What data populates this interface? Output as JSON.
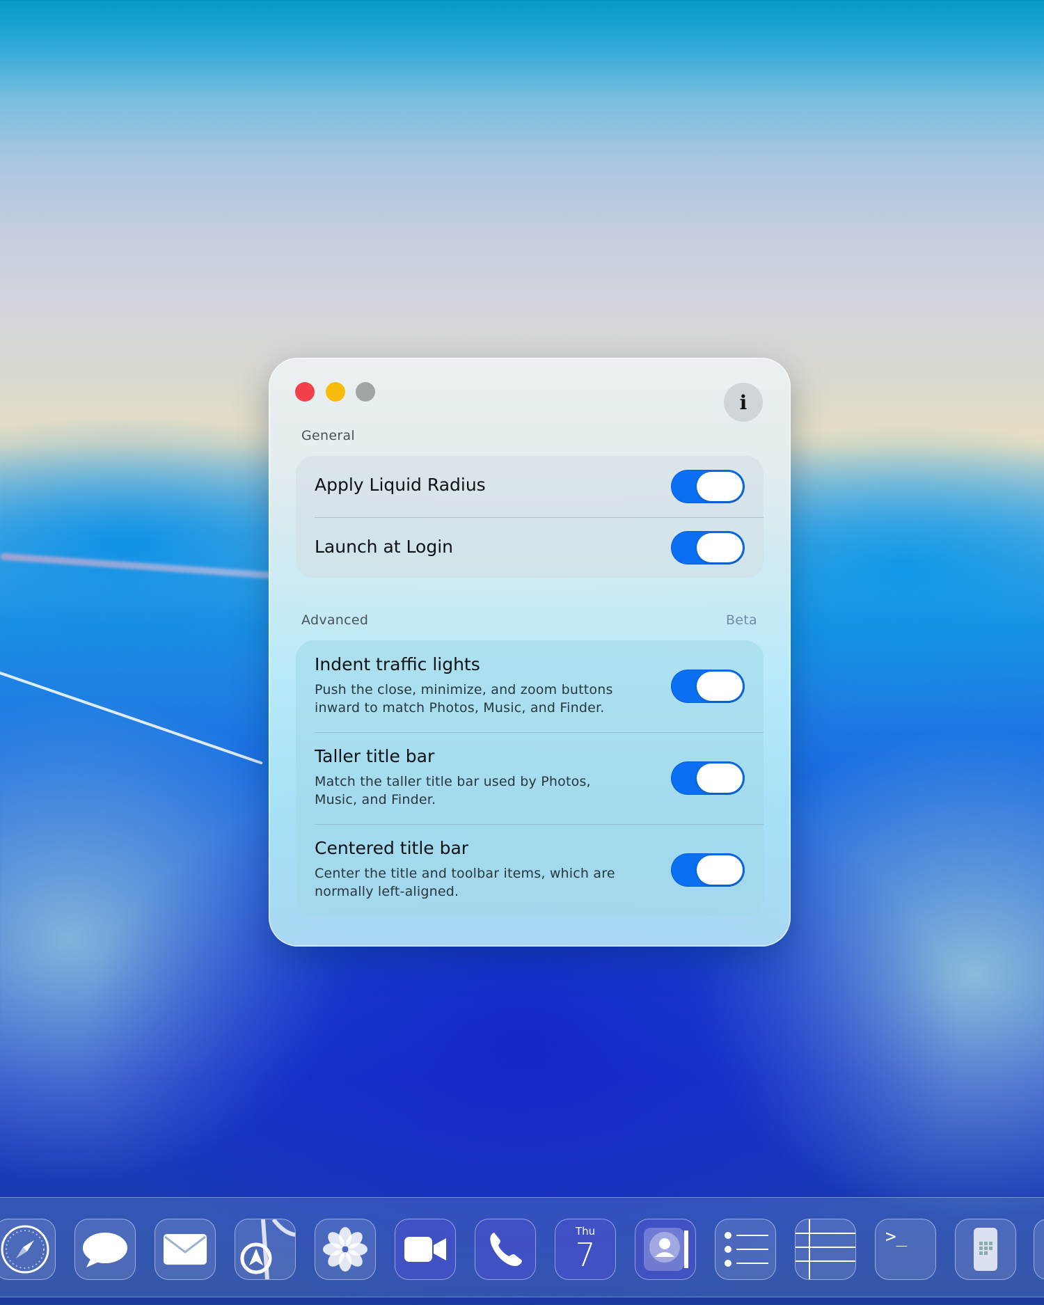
{
  "window": {
    "info_button_label": "i",
    "general": {
      "header": "General",
      "items": [
        {
          "title": "Apply Liquid Radius",
          "enabled": true
        },
        {
          "title": "Launch at Login",
          "enabled": true
        }
      ]
    },
    "advanced": {
      "header": "Advanced",
      "badge": "Beta",
      "items": [
        {
          "title": "Indent traffic lights",
          "description": "Push the close, minimize, and zoom buttons inward to match Photos, Music, and Finder.",
          "enabled": true
        },
        {
          "title": "Taller title bar",
          "description": "Match the taller title bar used by Photos, Music, and Finder.",
          "enabled": true
        },
        {
          "title": "Centered title bar",
          "description": "Center the title and toolbar items, which are normally left-aligned.",
          "enabled": true
        }
      ]
    }
  },
  "dock": {
    "calendar_day": "Thu",
    "calendar_date": "7",
    "terminal_glyph": ">_",
    "apps": [
      "safari-icon",
      "messages-icon",
      "mail-icon",
      "maps-icon",
      "photos-icon",
      "facetime-icon",
      "phone-icon",
      "calendar-icon",
      "contacts-icon",
      "reminders-icon",
      "numbers-icon",
      "terminal-icon",
      "simulator-icon"
    ]
  },
  "colors": {
    "toggle_on": "#0a6ff0",
    "close": "#f2414a",
    "minimize": "#f7bc0c",
    "zoom": "#a2a5a8"
  }
}
